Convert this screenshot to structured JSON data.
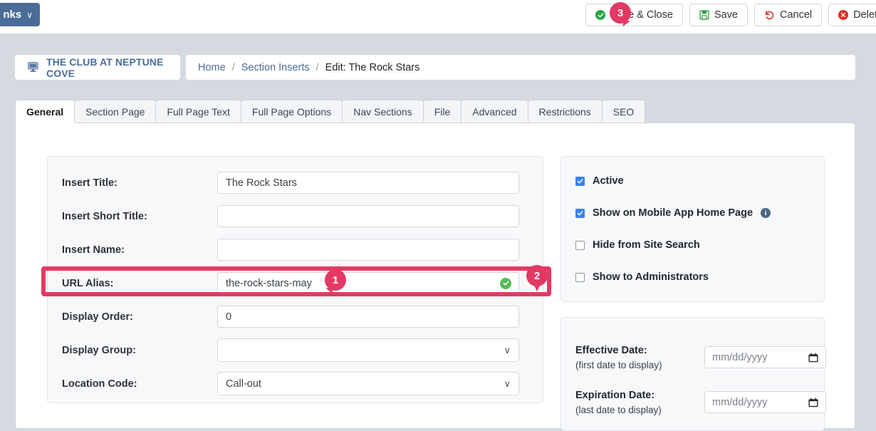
{
  "topbar": {
    "quicklinks_label": "nks",
    "quicklinks_caret": "∨",
    "buttons": [
      {
        "label": "Save & Close",
        "icon": "check-circle-icon"
      },
      {
        "label": "Save",
        "icon": "floppy-disk-icon"
      },
      {
        "label": "Cancel",
        "icon": "undo-arrow-icon"
      },
      {
        "label": "Delet",
        "icon": "x-circle-icon"
      }
    ]
  },
  "callouts": {
    "badge1": "1",
    "badge2": "2",
    "badge3": "3"
  },
  "breadcrumb": {
    "site_name": "THE CLUB AT NEPTUNE COVE",
    "items": [
      {
        "label": "Home",
        "current": false
      },
      {
        "label": "Section Inserts",
        "current": false
      },
      {
        "label": "Edit: The Rock Stars",
        "current": true
      }
    ],
    "separator": "/"
  },
  "tabs": [
    {
      "label": "General",
      "active": true
    },
    {
      "label": "Section Page",
      "active": false
    },
    {
      "label": "Full Page Text",
      "active": false
    },
    {
      "label": "Full Page Options",
      "active": false
    },
    {
      "label": "Nav Sections",
      "active": false
    },
    {
      "label": "File",
      "active": false
    },
    {
      "label": "Advanced",
      "active": false
    },
    {
      "label": "Restrictions",
      "active": false
    },
    {
      "label": "SEO",
      "active": false
    }
  ],
  "form": {
    "insert_title": {
      "label": "Insert Title:",
      "value": "The Rock Stars"
    },
    "insert_short_title": {
      "label": "Insert Short Title:",
      "value": ""
    },
    "insert_name": {
      "label": "Insert Name:",
      "value": ""
    },
    "url_alias": {
      "label": "URL Alias:",
      "value": "the-rock-stars-may",
      "valid_icon": "green-check-icon"
    },
    "display_order": {
      "label": "Display Order:",
      "value": "0"
    },
    "display_group": {
      "label": "Display Group:",
      "value": "",
      "caret": "∨"
    },
    "location_code": {
      "label": "Location Code:",
      "value": "Call-out",
      "caret": "∨"
    }
  },
  "options": {
    "checkboxes": [
      {
        "label": "Active",
        "checked": true,
        "info": false
      },
      {
        "label": "Show on Mobile App Home Page",
        "checked": true,
        "info": true
      },
      {
        "label": "Hide from Site Search",
        "checked": false,
        "info": false
      },
      {
        "label": "Show to Administrators",
        "checked": false,
        "info": false
      }
    ]
  },
  "dates": {
    "effective": {
      "label": "Effective Date:",
      "sub": "(first date to display)",
      "placeholder": "mm/dd/yyyy",
      "value": ""
    },
    "expiration": {
      "label": "Expiration Date:",
      "sub": "(last date to display)",
      "placeholder": "mm/dd/yyyy",
      "value": ""
    }
  },
  "colors": {
    "accent_blue": "#4a6c99",
    "highlight_pink": "#e23a63",
    "success_green": "#5cb85c",
    "danger_red": "#d93025",
    "checkbox_blue": "#3b82f6",
    "page_bg": "#d5dae1"
  }
}
